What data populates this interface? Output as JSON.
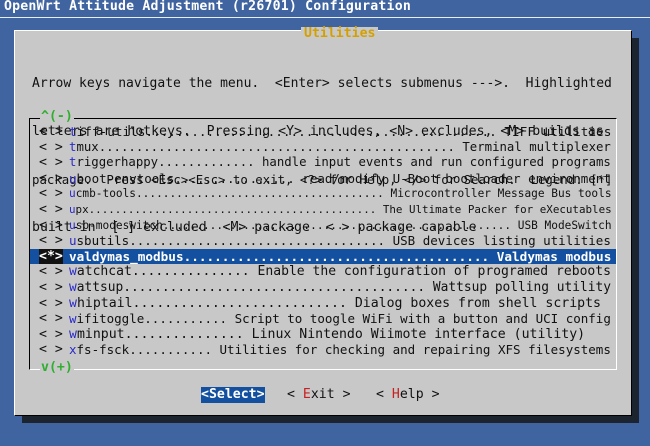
{
  "window": {
    "title": "OpenWrt Attitude Adjustment (r26701) Configuration"
  },
  "dialog": {
    "title": "Utilities",
    "help_lines": [
      "Arrow keys navigate the menu.  <Enter> selects submenus --->.  Highlighted",
      "letters are hotkeys.  Pressing <Y> includes, <N> excludes, <M> builds as",
      "package.  Press <Esc><Esc> to exit, <?> for Help, </> for Search.  Legend: [*]",
      "built-in  [ ] excluded  <M> package  < > package capable"
    ],
    "scroll_up": "^(-)",
    "scroll_down": "v(+)"
  },
  "menu": {
    "items": [
      {
        "mark": "< >",
        "hotkey": "t",
        "rest": "iff-utils.............................................. TIFF utilities"
      },
      {
        "mark": "< >",
        "hotkey": "t",
        "rest": "mux................................................ Terminal multiplexer"
      },
      {
        "mark": "< >",
        "hotkey": "t",
        "rest": "riggerhappy............. handle input events and run configured programs"
      },
      {
        "mark": "< >",
        "hotkey": "u",
        "rest": "boot-envtools................ read/modify U-Boot bootloader environment"
      },
      {
        "mark": "< >",
        "hotkey": "u",
        "rest": "cmb-tools..................................... Microcontroller Message Bus tools"
      },
      {
        "mark": "< >",
        "hotkey": "u",
        "rest": "px............................................ The Ultimate Packer for eXecutables"
      },
      {
        "mark": "< >",
        "hotkey": "u",
        "rest": "sb-modeswitch.................................................... USB ModeSwitch"
      },
      {
        "mark": "< >",
        "hotkey": "u",
        "rest": "sbutils.................................. USB devices listing utilities"
      },
      {
        "mark": "<*>",
        "hotkey": "v",
        "rest": "aldymas_modbus........................................ Valdymas modbus",
        "selected": true
      },
      {
        "mark": "< >",
        "hotkey": "w",
        "rest": "atchcat............... Enable the configuration of programed reboots"
      },
      {
        "mark": "< >",
        "hotkey": "w",
        "rest": "attsup....................................... Wattsup polling utility"
      },
      {
        "mark": "< >",
        "hotkey": "w",
        "rest": "hiptail........................... Dialog boxes from shell scripts"
      },
      {
        "mark": "< >",
        "hotkey": "w",
        "rest": "ifitoggle........... Script to toogle WiFi with a button and UCI config"
      },
      {
        "mark": "< >",
        "hotkey": "w",
        "rest": "minput............... Linux Nintendo Wiimote interface (utility)"
      },
      {
        "mark": "< >",
        "hotkey": "x",
        "rest": "fs-fsck........... Utilities for checking and repairing XFS filesystems"
      }
    ]
  },
  "buttons": {
    "select": {
      "open": "<",
      "hotkey": "S",
      "rest": "elect",
      "close": ">"
    },
    "exit": {
      "open": "< ",
      "hotkey": "E",
      "rest": "xit",
      "close": " >"
    },
    "help": {
      "open": "< ",
      "hotkey": "H",
      "rest": "elp",
      "close": " >"
    }
  },
  "colors": {
    "background": "#3f64a0",
    "dialog": "#c8c8c8",
    "selection": "#1450a0",
    "hotkey": "#2a2ac8",
    "title": "#d4a000",
    "scroll_indicator": "#2fae2f",
    "button_hotkey": "#c82020"
  }
}
